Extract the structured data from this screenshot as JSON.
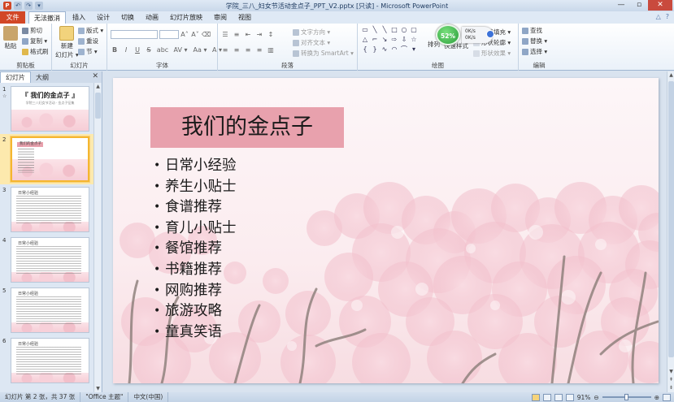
{
  "window": {
    "title": "学院_三八_妇女节活动金点子_PPT_V2.pptx [只读] - Microsoft PowerPoint",
    "minimize": "—",
    "maximize": "▫",
    "close": "✕"
  },
  "qat": [
    "P",
    "↶",
    "↷",
    "▾"
  ],
  "tabs": {
    "file": "文件",
    "items": [
      "无法撤消",
      "插入",
      "设计",
      "切换",
      "动画",
      "幻灯片放映",
      "审阅",
      "视图"
    ],
    "right": [
      "△",
      "?"
    ]
  },
  "ribbon": {
    "clipboard": {
      "label": "剪贴板",
      "paste": "粘贴",
      "cut": "剪切",
      "copy": "复制 ▾",
      "format_painter": "格式刷"
    },
    "slides": {
      "label": "幻灯片",
      "new_slide": "新建",
      "new_slide2": "幻灯片 ▾",
      "layout": "版式 ▾",
      "reset": "重设",
      "section": "节 ▾"
    },
    "font": {
      "label": "字体",
      "grow": "A˄",
      "shrink": "A˅",
      "clear": "⌫",
      "bold": "B",
      "italic": "I",
      "underline": "U",
      "strike": "S",
      "shadow": "abc",
      "spacing": "AV ▾",
      "case": "Aa ▾",
      "color": "A ▾"
    },
    "paragraph": {
      "label": "段落",
      "text_direction": "文字方向 ▾",
      "align_text": "对齐文本 ▾",
      "smartart": "转换为 SmartArt ▾"
    },
    "drawing": {
      "label": "绘图",
      "arrange": "排列",
      "quick_styles": "快速样式",
      "fill": "形状填充 ▾",
      "outline": "形状轮廓 ▾",
      "effects": "形状效果 ▾"
    },
    "editing": {
      "label": "编辑",
      "find": "查找",
      "replace": "替换 ▾",
      "select": "选择 ▾"
    }
  },
  "monitor": {
    "percent": "52%",
    "up": "0K/s",
    "down": "0K/s"
  },
  "panel": {
    "tab_slides": "幻灯片",
    "tab_outline": "大纲",
    "close": "✕",
    "thumbs": [
      {
        "num": "1",
        "sub": "☆",
        "title": "『 我们的金点子 』",
        "subtitle": "学院三八妇女节活动 · 金点子征集"
      },
      {
        "num": "2",
        "sub": "",
        "title": "我们的金点子"
      },
      {
        "num": "3",
        "sub": "",
        "title": "日常小经验"
      },
      {
        "num": "4",
        "sub": "",
        "title": "日常小经验"
      },
      {
        "num": "5",
        "sub": "",
        "title": "日常小经验"
      },
      {
        "num": "6",
        "sub": "",
        "title": "日常小经验"
      }
    ]
  },
  "slide": {
    "title": "我们的金点子",
    "bullets": [
      "日常小经验",
      "养生小贴士",
      "食谱推荐",
      "育儿小贴士",
      "餐馆推荐",
      "书籍推荐",
      "网购推荐",
      "旅游攻略",
      "童真笑语"
    ],
    "bullet_char": "•",
    "colors": {
      "title_box": "#e8a1ad",
      "blossom": "#f3c4cf",
      "branch": "#8a7d78"
    }
  },
  "statusbar": {
    "slide_info": "幻灯片 第 2 张，共 37 张",
    "theme": "\"Office 主题\"",
    "language": "中文(中国)",
    "zoom": "91%",
    "zoom_minus": "⊖",
    "zoom_plus": "⊕"
  }
}
